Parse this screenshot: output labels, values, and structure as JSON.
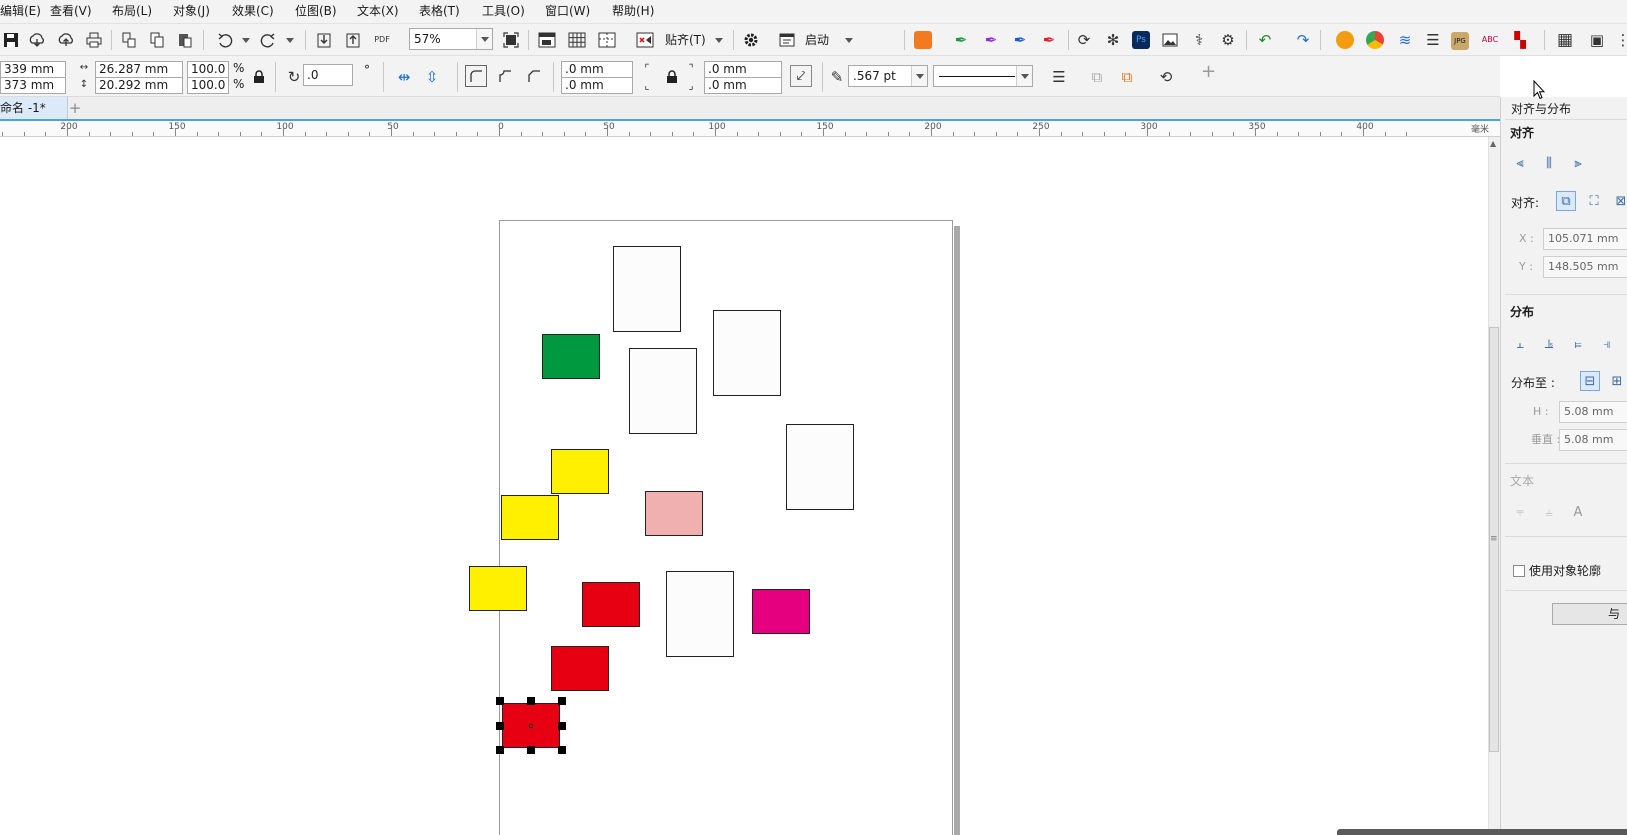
{
  "menu": [
    "编辑(E)",
    "查看(V)",
    "布局(L)",
    "对象(J)",
    "效果(C)",
    "位图(B)",
    "文本(X)",
    "表格(T)",
    "工具(O)",
    "窗口(W)",
    "帮助(H)"
  ],
  "toolbar1": {
    "zoom_value": "57%",
    "snap_label": "贴齐(T)",
    "launch_label": "启动",
    "pdf_label": "PDF",
    "icons": [
      "save-icon",
      "cloud-import-icon",
      "cloud-export-icon",
      "print-icon",
      "cut-icon",
      "copy-icon",
      "paste-icon",
      "undo-icon",
      "redo-icon",
      "import-icon",
      "export-icon",
      "pdf-icon",
      "full-screen-icon",
      "rulers-icon",
      "grid-icon",
      "guides-icon",
      "snap-off-icon",
      "gear-icon",
      "launch-icon"
    ]
  },
  "toolbar2": {
    "x_value": "339 mm",
    "y_value": "373 mm",
    "width_value": "26.287 mm",
    "height_value": "20.292 mm",
    "scale_x": "100.0",
    "scale_y": "100.0",
    "percent": "%",
    "angle_value": ".0",
    "degree": "°",
    "corner_top_left": ".0 mm",
    "corner_bottom_left": ".0 mm",
    "corner_top_right": ".0 mm",
    "corner_bottom_right": ".0 mm",
    "outline_width": ".567 pt",
    "plus": "+"
  },
  "doc_tab": "命名 -1*",
  "ruler": {
    "labels": [
      "200",
      "150",
      "100",
      "50",
      "0",
      "50",
      "100",
      "150",
      "200",
      "250",
      "300",
      "350",
      "400",
      "毫米"
    ]
  },
  "canvas": {
    "colors": {
      "green": "#00993f",
      "yellow": "#fff000",
      "pink": "#f0b0b0",
      "red": "#e60012",
      "magenta": "#e4007f",
      "white": "#fcfcfc"
    }
  },
  "panel": {
    "title": "对齐与分布",
    "align_section": "对齐",
    "align_to_label": "对齐:",
    "x_label": "X :",
    "x_value": "105.071 mm",
    "y_label": "Y :",
    "y_value": "148.505 mm",
    "distribute_section": "分布",
    "distribute_to_label": "分布至 :",
    "h_label": "H :",
    "h_value": "5.08 mm",
    "v_label": "垂直 :",
    "v_value": "5.08 mm",
    "text_section": "文本",
    "use_outline_label": "使用对象轮廓",
    "bottom_button": "与"
  }
}
